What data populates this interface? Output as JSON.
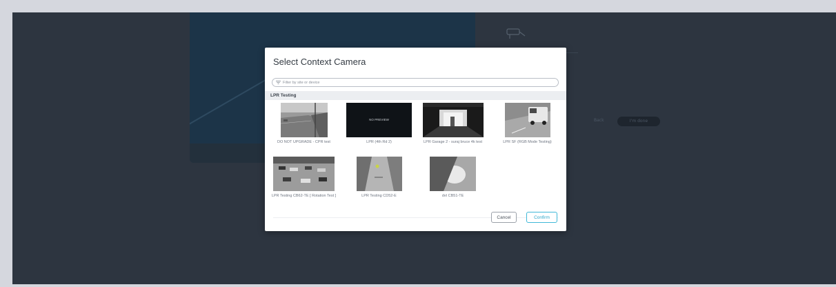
{
  "background": {
    "back_label": "Back",
    "done_label": "I'm done"
  },
  "modal": {
    "title": "Select Context Camera",
    "filter_placeholder": "Filter by site or device",
    "group_name": "LPR Testing",
    "no_preview_text": "NO PREVIEW",
    "cameras": [
      {
        "name": "DO NOT UPGRADE - CPR test",
        "thumbnail": "street-corner"
      },
      {
        "name": "LPR (4th Rd 2)",
        "thumbnail": "no-preview"
      },
      {
        "name": "LPR Garage 2 - suraj bruce 4k test",
        "thumbnail": "garage-entrance"
      },
      {
        "name": "LPR SF (RGB Mode Testing)",
        "thumbnail": "parked-van"
      },
      {
        "name": "LPR Testing CB62-TE [ Rotation Test ]",
        "thumbnail": "parking-lot"
      },
      {
        "name": "LPR Testing CD52-E",
        "thumbnail": "hallway"
      },
      {
        "name": "dvt CB51-TE",
        "thumbnail": "ceiling-corner"
      }
    ],
    "cancel_label": "Cancel",
    "confirm_label": "Confirm"
  },
  "colors": {
    "accent": "#3fb8d8",
    "backdrop": "#2d3540",
    "modal_bg": "#ffffff"
  }
}
